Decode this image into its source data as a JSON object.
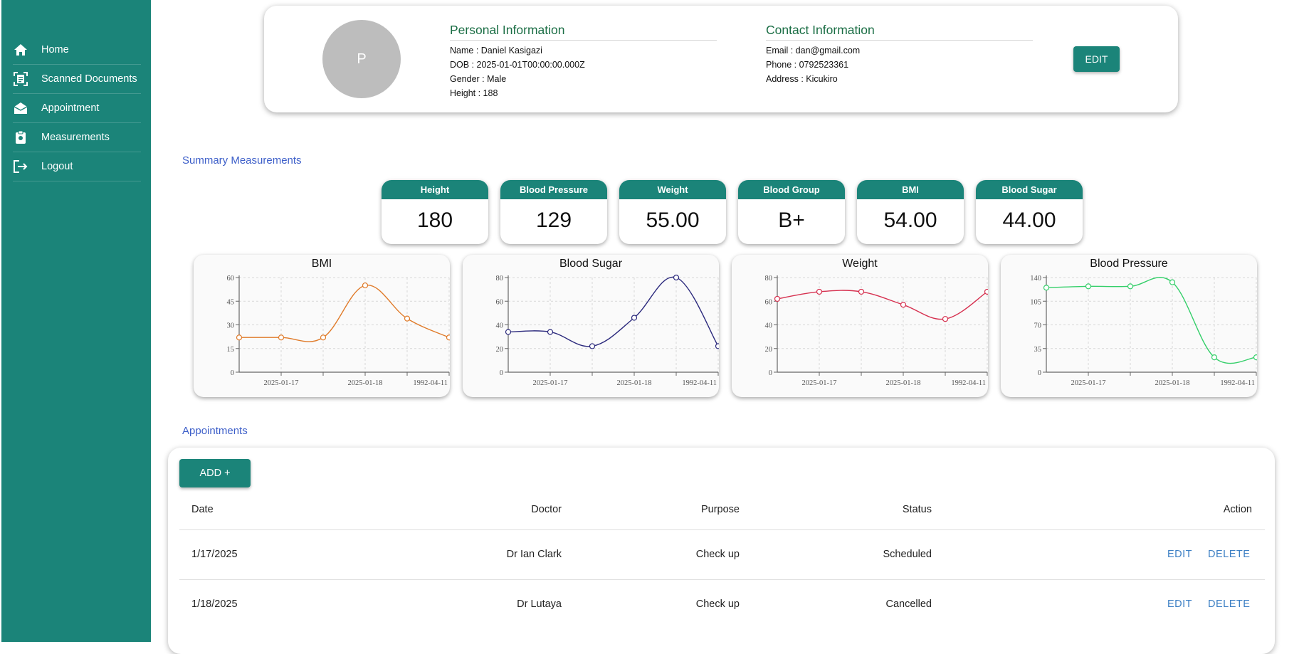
{
  "sidebar": {
    "items": [
      {
        "label": "Home",
        "icon": "home-icon"
      },
      {
        "label": "Scanned Documents",
        "icon": "document-scanner-icon"
      },
      {
        "label": "Appointment",
        "icon": "envelope-open-icon"
      },
      {
        "label": "Measurements",
        "icon": "clipboard-icon"
      },
      {
        "label": "Logout",
        "icon": "logout-icon"
      }
    ]
  },
  "profile": {
    "avatar_letter": "P",
    "personal_title": "Personal Information",
    "name": "Name : Daniel Kasigazi",
    "dob": "DOB : 2025-01-01T00:00:00.000Z",
    "gender": "Gender : Male",
    "height": "Height : 188",
    "contact_title": "Contact Information",
    "email": "Email : dan@gmail.com",
    "phone": "Phone : 0792523361",
    "address": "Address : Kicukiro",
    "edit_label": "EDIT"
  },
  "summary": {
    "title": "Summary Measurements",
    "cards": [
      {
        "label": "Height",
        "value": "180"
      },
      {
        "label": "Blood Pressure",
        "value": "129"
      },
      {
        "label": "Weight",
        "value": "55.00"
      },
      {
        "label": "Blood Group",
        "value": "B+"
      },
      {
        "label": "BMI",
        "value": "54.00"
      },
      {
        "label": "Blood Sugar",
        "value": "44.00"
      }
    ]
  },
  "chart_data": [
    {
      "type": "line",
      "title": "BMI",
      "color": "#e07b2a",
      "y_ticks": [
        0,
        15,
        30,
        45,
        60
      ],
      "ylim": [
        0,
        60
      ],
      "x_tick_labels": [
        "2025-01-17",
        "2025-01-18",
        "1992-04-11"
      ],
      "values": [
        22,
        22,
        22,
        55,
        34,
        22
      ]
    },
    {
      "type": "line",
      "title": "Blood Sugar",
      "color": "#2c2a7d",
      "y_ticks": [
        0,
        20,
        40,
        60,
        80
      ],
      "ylim": [
        0,
        80
      ],
      "x_tick_labels": [
        "2025-01-17",
        "2025-01-18",
        "1992-04-11"
      ],
      "values": [
        34,
        34,
        22,
        46,
        80,
        22
      ]
    },
    {
      "type": "line",
      "title": "Weight",
      "color": "#d6304f",
      "y_ticks": [
        0,
        20,
        40,
        60,
        80
      ],
      "ylim": [
        0,
        80
      ],
      "x_tick_labels": [
        "2025-01-17",
        "2025-01-18",
        "1992-04-11"
      ],
      "values": [
        62,
        68,
        68,
        57,
        45,
        68
      ]
    },
    {
      "type": "line",
      "title": "Blood Pressure",
      "color": "#35cf6a",
      "y_ticks": [
        0,
        35,
        70,
        105,
        140
      ],
      "ylim": [
        0,
        140
      ],
      "x_tick_labels": [
        "2025-01-17",
        "2025-01-18",
        "1992-04-11"
      ],
      "values": [
        125,
        127,
        127,
        133,
        22,
        22
      ]
    }
  ],
  "appointments": {
    "title": "Appointments",
    "add_label": "ADD +",
    "headers": {
      "date": "Date",
      "doctor": "Doctor",
      "purpose": "Purpose",
      "status": "Status",
      "action": "Action"
    },
    "rows": [
      {
        "date": "1/17/2025",
        "doctor": "Dr Ian Clark",
        "purpose": "Check up",
        "status": "Scheduled",
        "edit": "EDIT",
        "delete": "DELETE"
      },
      {
        "date": "1/18/2025",
        "doctor": "Dr Lutaya",
        "purpose": "Check up",
        "status": "Cancelled",
        "edit": "EDIT",
        "delete": "DELETE"
      }
    ]
  }
}
